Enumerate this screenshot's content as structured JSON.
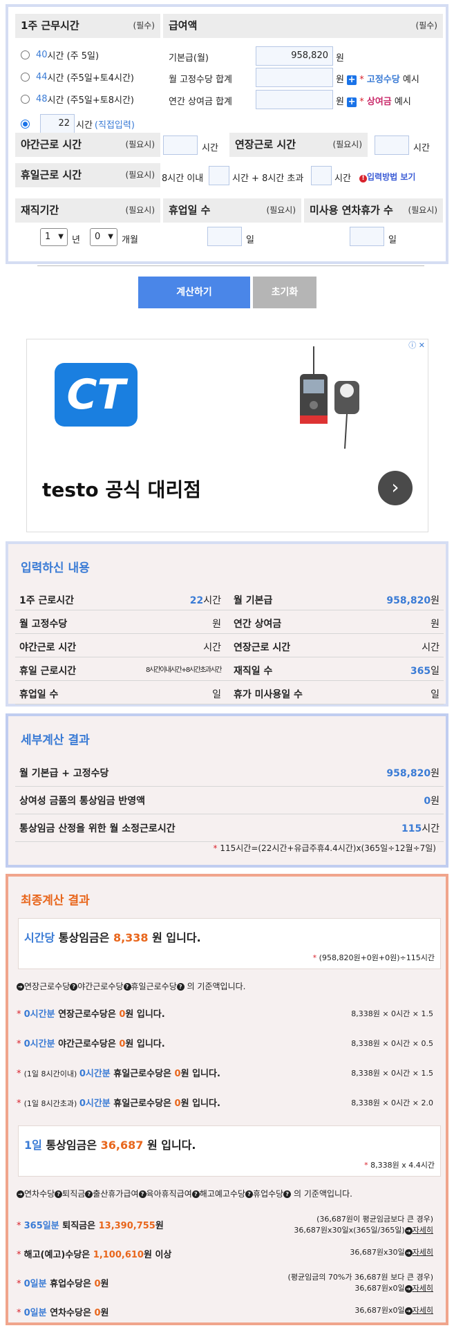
{
  "input": {
    "weekly_hours": {
      "title": "1주 근무시간",
      "req": "(필수)",
      "options": [
        {
          "num": "40",
          "text": "시간 (주 5일)"
        },
        {
          "num": "44",
          "text": "시간 (주5일+토4시간)"
        },
        {
          "num": "48",
          "text": "시간 (주5일+토8시간)"
        }
      ],
      "custom_value": "22",
      "custom_unit": "시간",
      "custom_label": "(직접입력)"
    },
    "pay": {
      "title": "급여액",
      "req": "(필수)",
      "base_label": "기본급(월)",
      "base_value": "958,820",
      "unit": "원",
      "fixed_label": "월 고정수당 합계",
      "fixed_example": "고정수당",
      "example": "예시",
      "bonus_label": "연간 상여금 합계",
      "bonus_example": "상여금"
    },
    "night": {
      "title": "야간근로 시간",
      "req": "(필요시)",
      "unit": "시간"
    },
    "overtime": {
      "title": "연장근로 시간",
      "req": "(필요시)",
      "unit": "시간"
    },
    "holiday": {
      "title": "휴일근로 시간",
      "req": "(필요시)",
      "within": "8시간 이내",
      "over": "시간 + 8시간 초과",
      "unit": "시간",
      "help": "입력방법 보기"
    },
    "tenure": {
      "title": "재직기간",
      "req": "(필요시)",
      "years": "1",
      "year_unit": "년",
      "months": "0",
      "month_unit": "개월"
    },
    "leave_days": {
      "title": "휴업일 수",
      "req": "(필요시)",
      "unit": "일"
    },
    "unused": {
      "title": "미사용 연차휴가 수",
      "req": "(필요시)",
      "unit": "일"
    },
    "calc_button": "계산하기",
    "reset_button": "초기화"
  },
  "ad": {
    "brand_text": "testo 공식 대리점",
    "logo_text": "CT"
  },
  "summary": {
    "title": "입력하신 내용",
    "rows": [
      {
        "k1": "1주 근로시간",
        "v1": "22",
        "u1": "시간",
        "k2": "월 기본급",
        "v2": "958,820",
        "u2": "원"
      },
      {
        "k1": "월 고정수당",
        "v1": "",
        "u1": "원",
        "k2": "연간 상여금",
        "v2": "",
        "u2": "원"
      },
      {
        "k1": "야간근로 시간",
        "v1": "",
        "u1": "시간",
        "k2": "연장근로 시간",
        "v2": "",
        "u2": "시간"
      },
      {
        "k1": "휴일 근로시간",
        "v1": "8시간이내시간+8시간초과시간",
        "u1": "",
        "k2": "재직일 수",
        "v2": "365",
        "u2": "일"
      },
      {
        "k1": "휴업일 수",
        "v1": "",
        "u1": "일",
        "k2": "휴가 미사용일 수",
        "v2": "",
        "u2": "일"
      }
    ]
  },
  "detail": {
    "title": "세부계산 결과",
    "rows": [
      {
        "k": "월 기본급 + 고정수당",
        "v": "958,820",
        "u": "원"
      },
      {
        "k": "상여성 금품의 통상임금 반영액",
        "v": "0",
        "u": "원"
      },
      {
        "k": "통상임금 산정을 위한 월 소정근로시간",
        "v": "115",
        "u": "시간"
      }
    ],
    "note": "* 115시간=(22시간+유급주휴4.4시간)x(365일÷12월÷7일)"
  },
  "final": {
    "title": "최종계산 결과",
    "hourly": {
      "pre": "시간당",
      "mid": "통상임금은",
      "value": "8,338",
      "post": "원 입니다.",
      "formula": "(958,820원+0원+0원)÷115시간"
    },
    "basis1": "연장근로수당 야간근로수당 휴일근로수당 의 기준액입니다.",
    "basis1_items": [
      "연장근로수당",
      "야간근로수당",
      "휴일근로수당"
    ],
    "basis1_tail": "의 기준액입니다.",
    "lines1": [
      {
        "pre": "",
        "hrs": "0시간분",
        "name": "연장근로수당은",
        "val": "0",
        "post": "원 입니다.",
        "calc": "8,338원 × 0시간 × 1.5"
      },
      {
        "pre": "",
        "hrs": "0시간분",
        "name": "야간근로수당은",
        "val": "0",
        "post": "원 입니다.",
        "calc": "8,338원 × 0시간 × 0.5"
      },
      {
        "pre": "(1일 8시간이내)",
        "hrs": "0시간분",
        "name": "휴일근로수당은",
        "val": "0",
        "post": "원 입니다.",
        "calc": "8,338원 × 0시간 × 1.5"
      },
      {
        "pre": "(1일 8시간초과)",
        "hrs": "0시간분",
        "name": "휴일근로수당은",
        "val": "0",
        "post": "원 입니다.",
        "calc": "8,338원 × 0시간 × 2.0"
      }
    ],
    "daily": {
      "pre": "1일",
      "mid": "통상임금은",
      "value": "36,687",
      "post": "원 입니다.",
      "formula": "8,338원 x 4.4시간"
    },
    "basis2_items": [
      "연차수당",
      "퇴직금",
      "출산휴가급여",
      "육아휴직급여",
      "해고예고수당",
      "휴업수당"
    ],
    "basis2_tail": "의 기준액입니다.",
    "lines2": [
      {
        "hl": "365일분",
        "name": "퇴직금은",
        "val": "13,390,755",
        "post": "원",
        "calc1": "(36,687원이 평균임금보다 큰 경우)",
        "calc2": "36,687원x30일x(365일/365일)",
        "more": "자세히"
      },
      {
        "hl": "",
        "name": "해고(예고)수당은",
        "val": "1,100,610",
        "post": "원 이상",
        "calc1": "",
        "calc2": "36,687원x30일",
        "more": "자세히"
      },
      {
        "hl": "0일분",
        "name": "휴업수당은",
        "val": "0",
        "post": "원",
        "calc1": "(평균임금의 70%가 36,687원 보다 큰 경우)",
        "calc2": "36,687원x0일",
        "more": "자세히"
      },
      {
        "hl": "0일분",
        "name": "연차수당은",
        "val": "0",
        "post": "원",
        "calc1": "",
        "calc2": "36,687원x0일",
        "more": "자세히"
      }
    ]
  },
  "colors": {
    "blue": "#3a7bd5",
    "orange": "#e8661c",
    "panel_border": "#d5ddf3",
    "final_border": "#f0a58c",
    "calc_btn": "#4a86e8",
    "reset_btn": "#b5b5b5"
  }
}
